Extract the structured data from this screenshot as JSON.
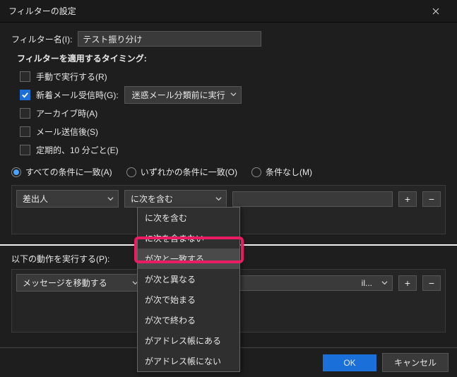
{
  "window": {
    "title": "フィルターの設定"
  },
  "filterName": {
    "label": "フィルター名(I):",
    "value": "テスト振り分け"
  },
  "timing": {
    "title": "フィルターを適用するタイミング:",
    "manual": "手動で実行する(R)",
    "onNewMail": "新着メール受信時(G):",
    "junkOption": "迷惑メール分類前に実行",
    "archive": "アーカイブ時(A)",
    "afterSend": "メール送信後(S)",
    "periodic": "定期的、10 分ごと(E)"
  },
  "match": {
    "all": "すべての条件に一致(A)",
    "any": "いずれかの条件に一致(O)",
    "none": "条件なし(M)"
  },
  "condition": {
    "field": "差出人",
    "operator": "に次を含む",
    "options": [
      "に次を含む",
      "に次を含まない",
      "が次と一致する",
      "が次と異なる",
      "が次で始まる",
      "が次で終わる",
      "がアドレス帳にある",
      "がアドレス帳にない"
    ]
  },
  "actions": {
    "label": "以下の動作を実行する(P):",
    "action": "メッセージを移動する",
    "targetSuffix": "il..."
  },
  "buttons": {
    "ok": "OK",
    "cancel": "キャンセル",
    "plus": "+",
    "minus": "−"
  }
}
